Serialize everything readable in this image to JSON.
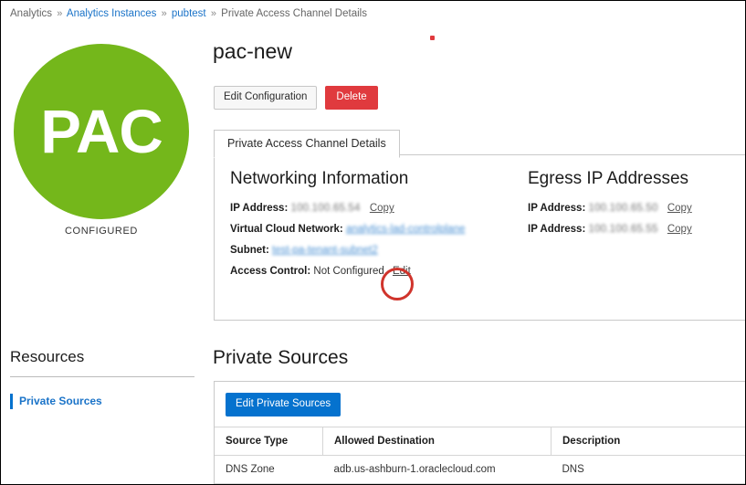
{
  "breadcrumb": {
    "separator": "»",
    "items": [
      {
        "label": "Analytics",
        "link": false
      },
      {
        "label": "Analytics Instances",
        "link": true
      },
      {
        "label": "pubtest",
        "link": true
      },
      {
        "label": "Private Access Channel Details",
        "link": false
      }
    ]
  },
  "badge": {
    "text": "PAC",
    "status": "CONFIGURED",
    "color": "#74b71b"
  },
  "sidebar": {
    "heading": "Resources",
    "items": [
      {
        "label": "Private Sources",
        "selected": true
      }
    ]
  },
  "header": {
    "title": "pac-new",
    "buttons": [
      {
        "label": "Edit Configuration",
        "style": "secondary"
      },
      {
        "label": "Delete",
        "style": "danger"
      }
    ]
  },
  "tabs": [
    {
      "label": "Private Access Channel Details",
      "active": true
    }
  ],
  "networking": {
    "title": "Networking Information",
    "ip_label": "IP Address:",
    "ip_value": "100.100.65.54",
    "ip_copy": "Copy",
    "vcn_label": "Virtual Cloud Network:",
    "vcn_value": "analytics-lad-controlplane",
    "subnet_label": "Subnet:",
    "subnet_value": "test-pa-tenant-subnet2",
    "access_control_label": "Access Control:",
    "access_control_value": "Not Configured",
    "access_control_edit": "Edit"
  },
  "egress": {
    "title": "Egress IP Addresses",
    "rows": [
      {
        "label": "IP Address:",
        "value": "100.100.65.50",
        "copy": "Copy"
      },
      {
        "label": "IP Address:",
        "value": "100.100.65.55",
        "copy": "Copy"
      }
    ]
  },
  "private_sources": {
    "heading": "Private Sources",
    "edit_button": "Edit Private Sources",
    "columns": [
      "Source Type",
      "Allowed Destination",
      "Description"
    ],
    "rows": [
      {
        "source_type": "DNS Zone",
        "allowed_destination": "adb.us-ashburn-1.oraclecloud.com",
        "description": "DNS"
      }
    ]
  },
  "annotation": {
    "shape": "red-ellipse",
    "color": "#d0342c",
    "targets": "Access Control Edit link"
  },
  "colors": {
    "link": "#1a73c8",
    "primary": "#0572ce",
    "danger": "#e03a3e",
    "badge_green": "#74b71b",
    "annotation_red": "#d0342c"
  }
}
